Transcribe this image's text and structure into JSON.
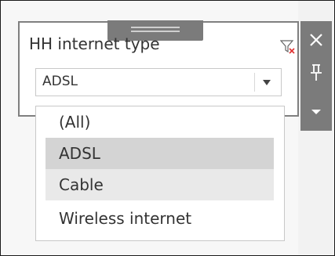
{
  "filter_card": {
    "title": "HH internet type",
    "clear_filter_icon": "clear-filter-icon",
    "selected_value": "ADSL"
  },
  "dropdown": {
    "options": [
      {
        "label": "(All)",
        "state": "normal"
      },
      {
        "label": "ADSL",
        "state": "selected"
      },
      {
        "label": "Cable",
        "state": "hover"
      },
      {
        "label": "Wireless internet",
        "state": "normal"
      }
    ]
  },
  "toolbar": {
    "icons": [
      "close-icon",
      "pin-icon",
      "more-options-icon"
    ]
  },
  "colors": {
    "toolbar_bg": "#7b7b7b",
    "selected_bg": "#d4d4d4",
    "hover_bg": "#e9e9e9",
    "clear_filter_accent": "#e03030",
    "text": "#333333"
  }
}
